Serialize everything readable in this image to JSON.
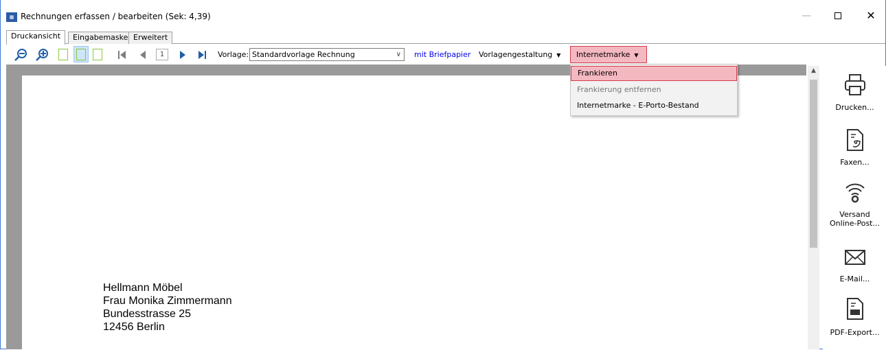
{
  "window": {
    "title": "Rechnungen erfassen / bearbeiten (Sek: 4,39)",
    "controls": {
      "minimize": "—",
      "close": "✕"
    }
  },
  "tabs": [
    {
      "label": "Druckansicht",
      "active": true
    },
    {
      "label": "Eingabemaske",
      "active": false
    },
    {
      "label": "Erweitert",
      "active": false
    }
  ],
  "toolbar": {
    "page_number": "1",
    "vorlage_label": "Vorlage:",
    "vorlage_value": "Standardvorlage Rechnung",
    "briefpapier_link": "mit Briefpapier",
    "vorlagengestaltung_label": "Vorlagengestaltung",
    "internetmarke_label": "Internetmarke"
  },
  "dropdown_menu": {
    "items": [
      {
        "label": "Frankieren",
        "highlighted": true,
        "enabled": true
      },
      {
        "label": "Frankierung entfernen",
        "highlighted": false,
        "enabled": false
      },
      {
        "label": "Internetmarke - E-Porto-Bestand",
        "highlighted": false,
        "enabled": true
      }
    ]
  },
  "document": {
    "address_lines": [
      "Hellmann Möbel",
      "Frau Monika Zimmermann",
      "Bundesstrasse 25",
      "12456 Berlin"
    ]
  },
  "sidebar": {
    "items": [
      {
        "label": "Drucken...",
        "icon": "printer-icon"
      },
      {
        "label": "Faxen...",
        "icon": "fax-icon"
      },
      {
        "label": "Versand Online-Post...",
        "label_line1": "Versand",
        "label_line2": "Online-Post...",
        "icon": "wireless-icon"
      },
      {
        "label": "E-Mail...",
        "icon": "email-icon"
      },
      {
        "label": "PDF-Export...",
        "icon": "pdf-icon"
      }
    ]
  },
  "colors": {
    "highlight_fill": "#f4b8c1",
    "highlight_border": "#d43a4a",
    "link": "#0000ee",
    "page_icon_green": "#8cc63f",
    "nav_blue": "#1f5fa8"
  }
}
